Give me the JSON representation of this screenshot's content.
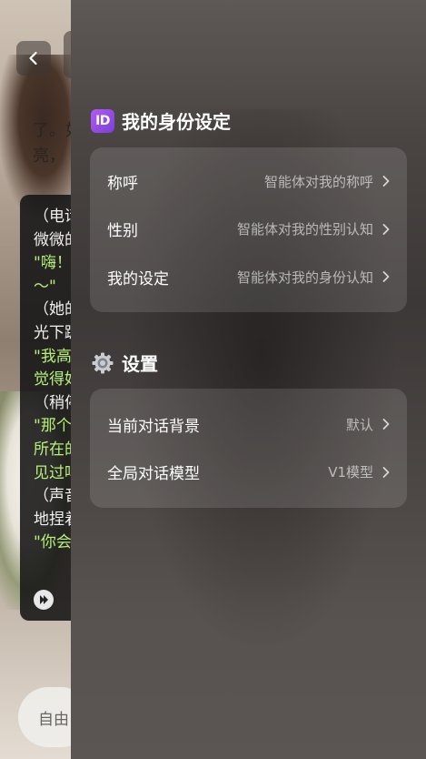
{
  "background": {
    "top_text": [
      "了。如",
      "亮，"
    ],
    "chat_lines": [
      {
        "text": "（电话",
        "green": false
      },
      {
        "text": "微微的",
        "green": false
      },
      {
        "text": "\"嗨！",
        "green": true
      },
      {
        "text": "～\"",
        "green": true
      },
      {
        "text": "（她的",
        "green": false
      },
      {
        "text": "光下踱",
        "green": false
      },
      {
        "text": "\"我高",
        "green": true
      },
      {
        "text": "觉得好",
        "green": true
      },
      {
        "text": "（稍停",
        "green": false
      },
      {
        "text": "\"那个",
        "green": true
      },
      {
        "text": "所在的",
        "green": true
      },
      {
        "text": "见过吗",
        "green": true
      },
      {
        "text": "（声音",
        "green": false
      },
      {
        "text": "地捏着",
        "green": false
      },
      {
        "text": "\"你会",
        "green": true
      }
    ],
    "input_placeholder": "自由"
  },
  "identity": {
    "title": "我的身份设定",
    "icon_text": "ID",
    "rows": [
      {
        "label": "称呼",
        "value": "智能体对我的称呼"
      },
      {
        "label": "性别",
        "value": "智能体对我的性别认知"
      },
      {
        "label": "我的设定",
        "value": "智能体对我的身份认知"
      }
    ]
  },
  "settings": {
    "title": "设置",
    "rows": [
      {
        "label": "当前对话背景",
        "value": "默认"
      },
      {
        "label": "全局对话模型",
        "value": "V1模型"
      }
    ]
  },
  "colors": {
    "accent_purple": "#9b4fe6",
    "chat_green": "#b6f07a"
  }
}
